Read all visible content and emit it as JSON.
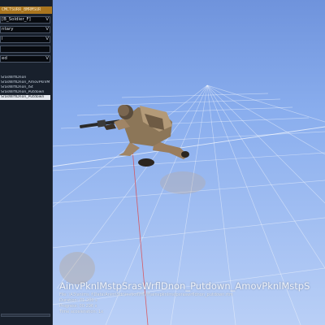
{
  "panel": {
    "title": "CMCTSURR_BMRMSUR",
    "fields": [
      {
        "label": "[B_Soldier_F]"
      },
      {
        "label": "ntary"
      },
      {
        "label": "l"
      },
      {
        "label": ""
      },
      {
        "label": "ed"
      }
    ],
    "animations": [
      "SrasWrflDnon",
      "SrasWrflDnon_AmovPknlM",
      "SrasWrflDnon_ISt",
      "SrasWrflDnon_Putdown",
      "SrasWrflDnon_Putdown"
    ],
    "selected_index": 4
  },
  "overlay": {
    "animation_name": "AinvPknlMstpSrasWrflDnon_Putdown_AmovPknlMstpS",
    "file": "File: \\A3\\anims_f\\Data\\Anim\\Sdr\\inv\\knl\\rfl\\rfl\\ainvpknlmstpsraswrfldnon_putdown.rtm",
    "duration": "Duration: 01.200 s",
    "progress": "Progress: 00.296 s",
    "time_acceleration": "Time acceleration: 1x"
  },
  "colors": {
    "panel_bg": "#18202c",
    "title_bar": "#a9751f",
    "sky_top": "#6f93dc",
    "sky_bottom": "#b9cff6",
    "grid_line": "#ffffff"
  },
  "icons": {
    "dropdown": "chevron-down-icon"
  }
}
